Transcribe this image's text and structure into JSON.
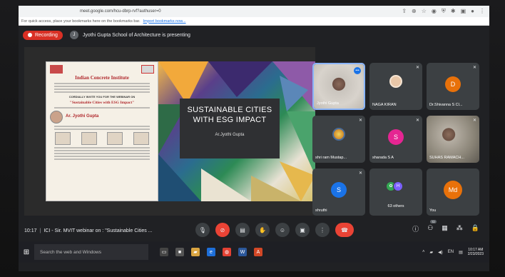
{
  "browser": {
    "url": "meet.google.com/hcu-dbrp-rvf?authuser=0",
    "bookmarks_hint": "For quick access, place your bookmarks here on the bookmarks bar.",
    "import_link": "Import bookmarks now..."
  },
  "meet": {
    "recording_label": "Recording",
    "presenter_text": "Jyothi Gupta School of Architecture is presenting",
    "time": "10:17",
    "meeting_title": "ICI - Sir. MVIT webinar on : \"Sustainable Cities ...",
    "people_count": "72"
  },
  "slide": {
    "poster_title": "Indian Concrete Institute",
    "poster_invite": "CORDIALLY INVITE YOU FOR THE WEBINAR ON",
    "poster_topic": "\"Sustainable Cities with ESG Impact\"",
    "poster_speaker": "Ar. Jyothi Gupta",
    "main_title": "SUSTAINABLE CITIES WITH ESG IMPACT",
    "author": "Ar.Jyothi Gupta"
  },
  "participants": [
    {
      "name": "Jyothi Gupta",
      "kind": "video-female"
    },
    {
      "name": "NAGA KIRAN",
      "kind": "photo"
    },
    {
      "name": "Dr.Shivanna S Cl...",
      "initial": "D",
      "color": "#e8710a"
    },
    {
      "name": "shri ram Mustap...",
      "kind": "deity"
    },
    {
      "name": "sharada S A",
      "initial": "S",
      "color": "#e52592"
    },
    {
      "name": "SUHAS RAMACH...",
      "kind": "video-male"
    },
    {
      "name": "shruthi",
      "initial": "S",
      "color": "#1a73e8"
    },
    {
      "name": "63 others",
      "kind": "group"
    },
    {
      "name": "You",
      "initial": "Md",
      "color": "#e8710a"
    }
  ],
  "taskbar": {
    "search_placeholder": "Search the web and Windows",
    "clock_time": "10:17 AM",
    "clock_date": "2/23/2023"
  }
}
